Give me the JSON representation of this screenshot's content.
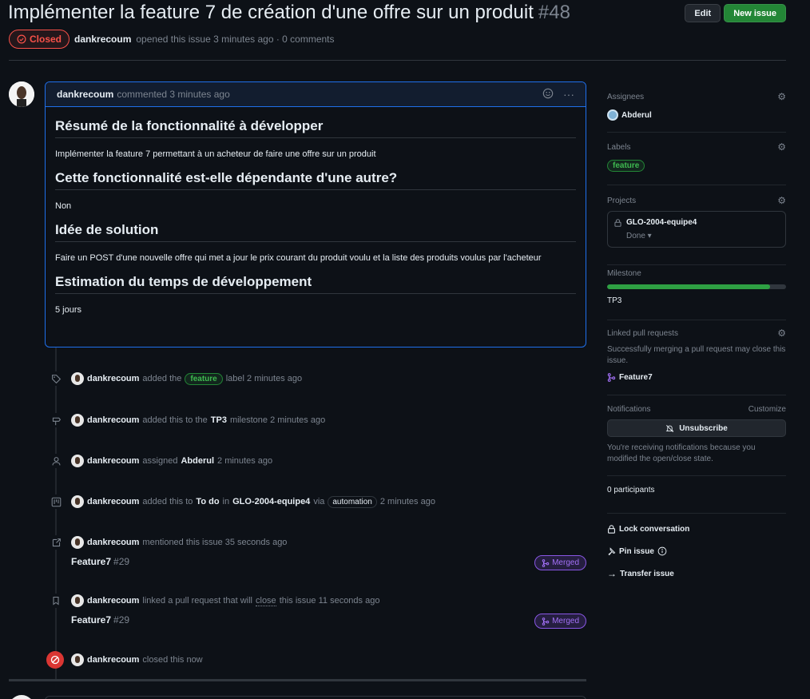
{
  "header": {
    "title": "Implémenter la feature 7 de création d'une offre sur un produit",
    "number": "#48",
    "edit_label": "Edit",
    "new_issue_label": "New issue",
    "state_label": "Closed",
    "author": "dankrecoum",
    "opened_text": "opened this issue 3 minutes ago · 0 comments"
  },
  "comment": {
    "author": "dankrecoum",
    "meta": "commented 3 minutes ago",
    "sections": [
      {
        "heading": "Résumé de la fonctionnalité à développer",
        "text": "Implémenter la feature 7 permettant à un acheteur de faire une offre sur un produit"
      },
      {
        "heading": "Cette fonctionnalité est-elle dépendante d'une autre?",
        "text": "Non"
      },
      {
        "heading": "Idée de solution",
        "text": "Faire un POST d'une nouvelle offre qui met a jour le prix courant du produit voulu et la liste des produits voulus par l'acheteur"
      },
      {
        "heading": "Estimation du temps de développement",
        "text": "5 jours"
      }
    ]
  },
  "timeline": {
    "label_event": {
      "icon": "tag-icon",
      "who": "dankrecoum",
      "pre": "added the",
      "label": "feature",
      "post": "label 2 minutes ago"
    },
    "milestone_event": {
      "icon": "milestone-icon",
      "who": "dankrecoum",
      "pre": "added this to the",
      "milestone": "TP3",
      "post": "milestone 2 minutes ago"
    },
    "assign_event": {
      "icon": "person-icon",
      "who": "dankrecoum",
      "pre": "assigned",
      "assignee": "Abderul",
      "post": "2 minutes ago"
    },
    "project_event": {
      "icon": "project-icon",
      "who": "dankrecoum",
      "pre": "added this to",
      "column": "To do",
      "mid": "in",
      "project": "GLO-2004-equipe4",
      "via": "via",
      "badge": "automation",
      "post": "2 minutes ago"
    },
    "mention_event": {
      "icon": "cross-reference-icon",
      "who": "dankrecoum",
      "text": "mentioned this issue 35 seconds ago",
      "pr_title": "Feature7",
      "pr_number": "#29",
      "pr_state": "Merged"
    },
    "link_event": {
      "icon": "bookmark-icon",
      "who": "dankrecoum",
      "pre": "linked a pull request that will",
      "close_word": "close",
      "post": "this issue 11 seconds ago",
      "pr_title": "Feature7",
      "pr_number": "#29",
      "pr_state": "Merged"
    },
    "close_event": {
      "icon": "closed-circle-icon",
      "who": "dankrecoum",
      "text": "closed this now"
    }
  },
  "sidebar": {
    "assignees": {
      "heading": "Assignees",
      "value": "Abderul"
    },
    "labels": {
      "heading": "Labels",
      "value": "feature"
    },
    "projects": {
      "heading": "Projects",
      "name": "GLO-2004-equipe4",
      "status": "Done ▾"
    },
    "milestone": {
      "heading": "Milestone",
      "value": "TP3",
      "progress_percent": 91
    },
    "linked_prs": {
      "heading": "Linked pull requests",
      "note": "Successfully merging a pull request may close this issue.",
      "pr": "Feature7"
    },
    "notifications": {
      "heading": "Notifications",
      "customize": "Customize",
      "button": "Unsubscribe",
      "note": "You're receiving notifications because you modified the open/close state."
    },
    "participants": "0 participants",
    "actions": {
      "lock": "Lock conversation",
      "pin": "Pin issue",
      "transfer": "Transfer issue"
    }
  },
  "colors": {
    "accent_blue": "#1f6feb",
    "closed_red": "#f85149",
    "merged_purple": "#a371f7",
    "label_green": "#3fb950"
  }
}
